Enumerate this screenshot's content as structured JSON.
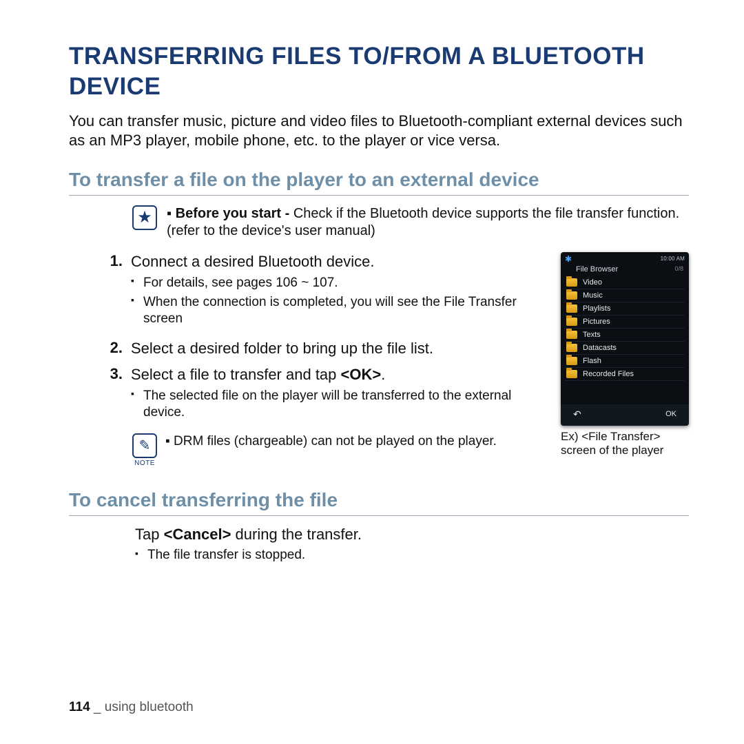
{
  "title": "TRANSFERRING FILES TO/FROM A BLUETOOTH DEVICE",
  "intro": "You can transfer music, picture and video files to Bluetooth-compliant external devices such as an MP3 player, mobile phone, etc. to the player or vice versa.",
  "section1_heading": "To transfer a file on the player to an external device",
  "before_start": {
    "lead": "Before you start - ",
    "body": "Check if the Bluetooth device supports the file transfer function. (refer to the device's user manual)"
  },
  "steps": [
    {
      "num": "1.",
      "text": "Connect a desired Bluetooth device.",
      "sub": [
        "For details, see pages 106 ~ 107.",
        "When the connection is completed, you will see the File Transfer screen"
      ]
    },
    {
      "num": "2.",
      "text": "Select a desired folder to bring up the file list.",
      "sub": []
    },
    {
      "num": "3.",
      "text_pre": "Select a file to transfer and tap ",
      "text_bold": "<OK>",
      "text_post": ".",
      "sub": [
        "The selected file on the player will be transferred to the external device."
      ]
    }
  ],
  "drm_note": "DRM files (chargeable) can not be played on the player.",
  "note_label": "NOTE",
  "device": {
    "time": "10:00 AM",
    "breadcrumb": "File Browser",
    "counter": "0/8",
    "items": [
      "Video",
      "Music",
      "Playlists",
      "Pictures",
      "Texts",
      "Datacasts",
      "Flash",
      "Recorded Files"
    ],
    "ok": "OK"
  },
  "device_caption": "Ex) <File Transfer> screen of the player",
  "section2_heading": "To cancel transferring the file",
  "cancel": {
    "pre": "Tap ",
    "bold": "<Cancel>",
    "post": " during the transfer.",
    "sub": "The file transfer is stopped."
  },
  "footer": {
    "page": "114",
    "sep": " _ ",
    "section": "using bluetooth"
  }
}
